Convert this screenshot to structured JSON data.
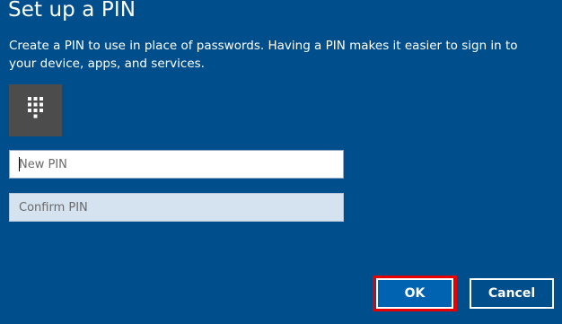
{
  "dialog": {
    "title": "Set up a PIN",
    "description": "Create a PIN to use in place of passwords. Having a PIN makes it easier to sign in to your device, apps, and services."
  },
  "icons": {
    "keypad": "keypad-icon"
  },
  "fields": {
    "new_pin": {
      "placeholder": "New PIN",
      "value": ""
    },
    "confirm_pin": {
      "placeholder": "Confirm PIN",
      "value": ""
    }
  },
  "buttons": {
    "ok_label": "OK",
    "cancel_label": "Cancel"
  },
  "colors": {
    "background": "#004E8C",
    "keypad_tile": "#4C4C4C",
    "highlight": "#E60000"
  }
}
